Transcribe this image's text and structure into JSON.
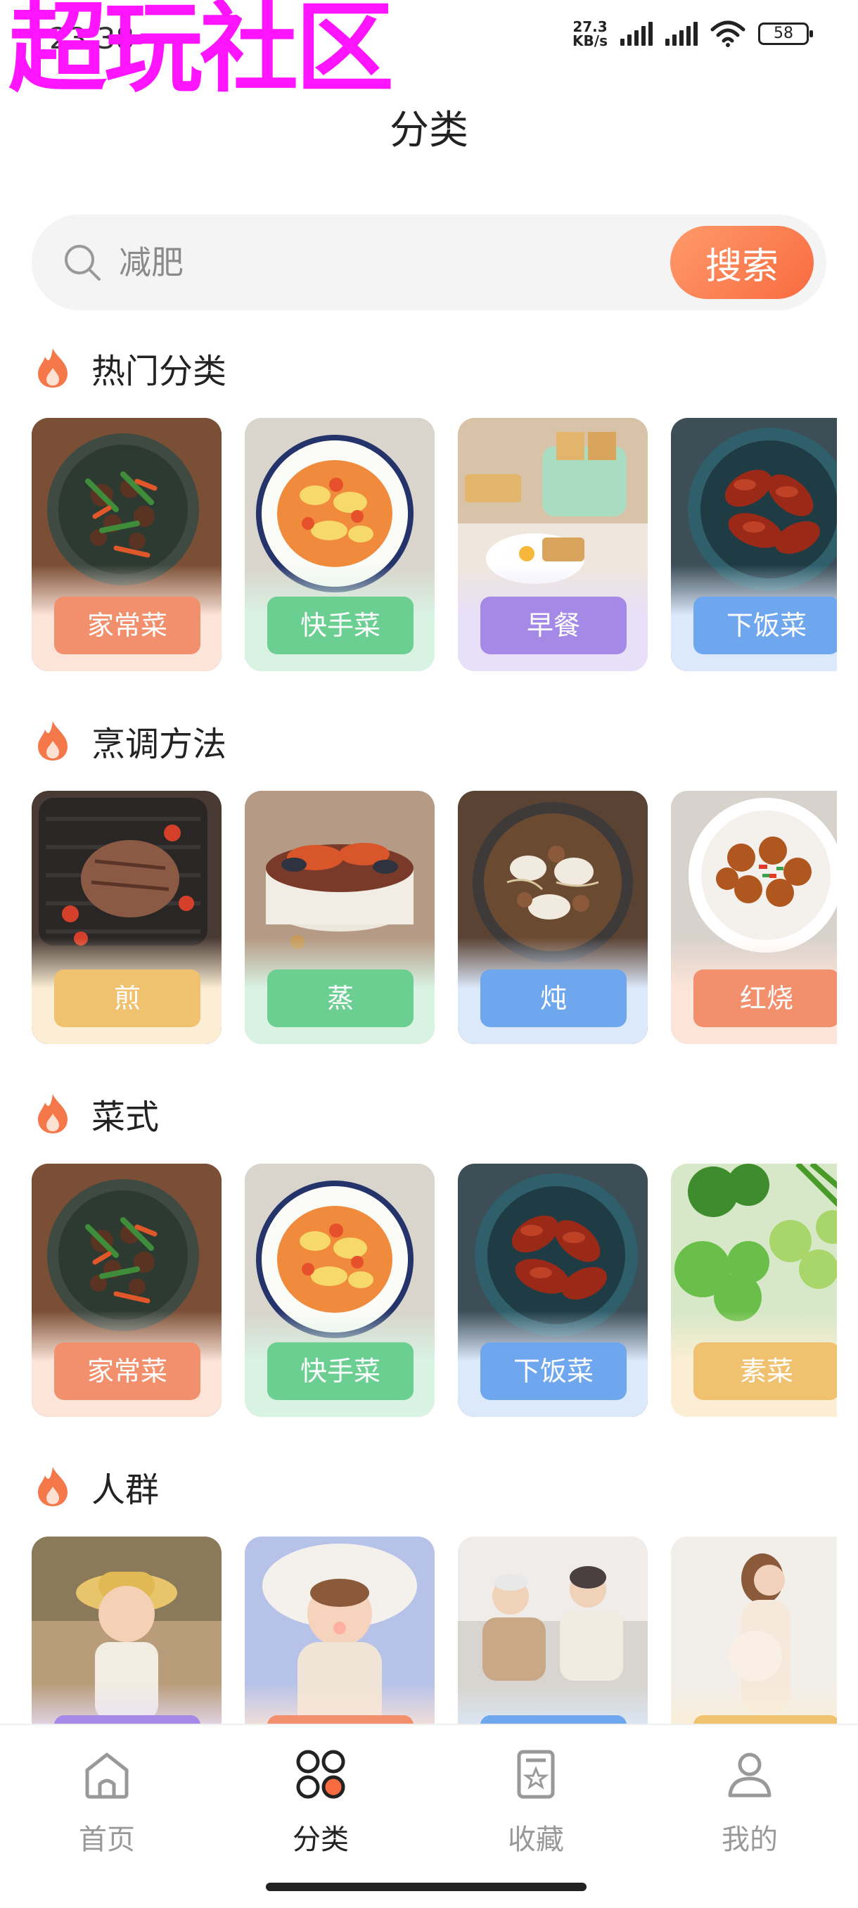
{
  "status_bar": {
    "watermark": "超玩社区",
    "time": "23:38",
    "net_speed_value": "27.3",
    "net_speed_unit": "KB/s",
    "battery": "58"
  },
  "header": {
    "title": "分类"
  },
  "search": {
    "placeholder": "减肥",
    "button_label": "搜索"
  },
  "sections": [
    {
      "title": "热门分类",
      "cards": [
        {
          "label": "家常菜",
          "label_color": "#f2906e",
          "bg": "#fde4d8",
          "image": "beef-stir-fry"
        },
        {
          "label": "快手菜",
          "label_color": "#6bcf92",
          "bg": "#d9f3e3",
          "image": "tomato-egg-dish"
        },
        {
          "label": "早餐",
          "label_color": "#a48ae6",
          "bg": "#e8dff9",
          "image": "toast-breakfast"
        },
        {
          "label": "下饭菜",
          "label_color": "#6ea7ee",
          "bg": "#dce9fb",
          "image": "braised-chicken-wings"
        }
      ]
    },
    {
      "title": "烹调方法",
      "cards": [
        {
          "label": "煎",
          "label_color": "#f0c16f",
          "bg": "#fbeed4",
          "image": "grilled-steak"
        },
        {
          "label": "蒸",
          "label_color": "#6bcf92",
          "bg": "#d9f3e3",
          "image": "seafood-steamer"
        },
        {
          "label": "炖",
          "label_color": "#6ea7ee",
          "bg": "#dce9fb",
          "image": "stew-pot"
        },
        {
          "label": "红烧",
          "label_color": "#f2906e",
          "bg": "#fde4d8",
          "image": "braised-meatballs"
        }
      ]
    },
    {
      "title": "菜式",
      "cards": [
        {
          "label": "家常菜",
          "label_color": "#f2906e",
          "bg": "#fde4d8",
          "image": "beef-stir-fry"
        },
        {
          "label": "快手菜",
          "label_color": "#6bcf92",
          "bg": "#d9f3e3",
          "image": "tomato-egg-dish"
        },
        {
          "label": "下饭菜",
          "label_color": "#6ea7ee",
          "bg": "#dce9fb",
          "image": "braised-chicken-wings"
        },
        {
          "label": "素菜",
          "label_color": "#f0c16f",
          "bg": "#fbeed4",
          "image": "green-vegetables"
        }
      ]
    },
    {
      "title": "人群",
      "cards": [
        {
          "label": "",
          "label_color": "#a48ae6",
          "bg": "#e8dff9",
          "image": "toddler-photo"
        },
        {
          "label": "",
          "label_color": "#f2906e",
          "bg": "#fde4d8",
          "image": "baby-photo"
        },
        {
          "label": "",
          "label_color": "#6ea7ee",
          "bg": "#dce9fb",
          "image": "elderly-couple-photo"
        },
        {
          "label": "",
          "label_color": "#f0c16f",
          "bg": "#fbeed4",
          "image": "pregnant-woman-photo"
        }
      ]
    }
  ],
  "tab_bar": {
    "items": [
      {
        "label": "首页",
        "icon": "home-icon",
        "active": false
      },
      {
        "label": "分类",
        "icon": "category-icon",
        "active": true
      },
      {
        "label": "收藏",
        "icon": "favorites-icon",
        "active": false
      },
      {
        "label": "我的",
        "icon": "profile-icon",
        "active": false
      }
    ]
  },
  "colors": {
    "accent": "#f86b3f",
    "search_bg": "#f3f4f3",
    "flame": "#f5784a"
  }
}
